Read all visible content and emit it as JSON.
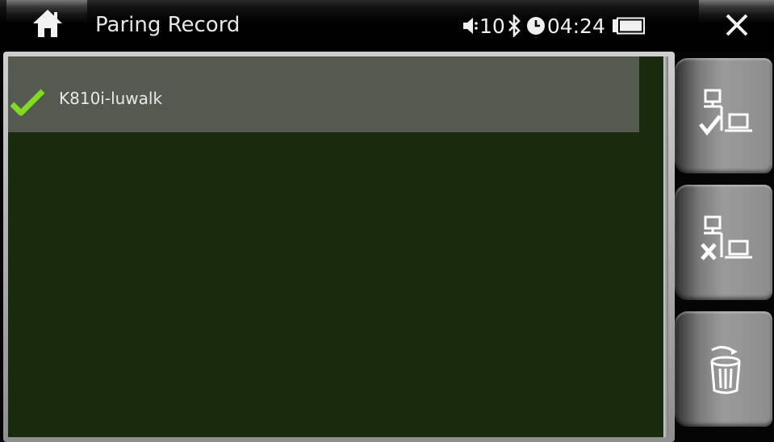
{
  "header": {
    "title": "Paring Record"
  },
  "status_bar": {
    "volume_level": "10",
    "time": "04:24",
    "icons": [
      "speaker-icon",
      "bluetooth-icon",
      "clock-icon",
      "battery-icon"
    ]
  },
  "devices": [
    {
      "name": "K810i-luwalk",
      "status_icon": "check-icon",
      "selected": true
    }
  ],
  "side_buttons": [
    {
      "name": "connect",
      "icon": "connect-device-icon"
    },
    {
      "name": "disconnect",
      "icon": "disconnect-device-icon"
    },
    {
      "name": "delete",
      "icon": "trash-icon"
    }
  ],
  "colors": {
    "list_background": "#1a2a0c",
    "selected_row": "#555a51",
    "check": "#7fdc22"
  }
}
